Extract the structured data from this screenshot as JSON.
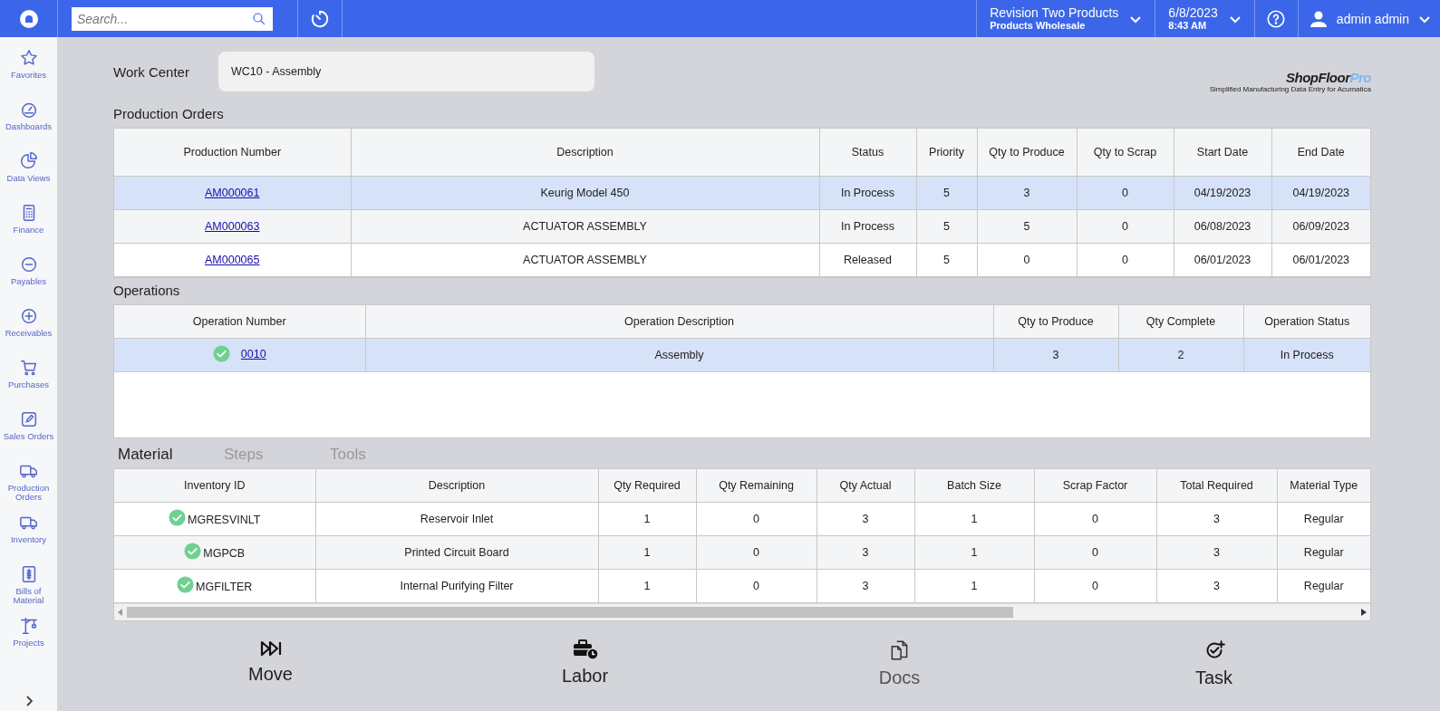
{
  "top_bar": {
    "search": {
      "placeholder": "Search..."
    },
    "company": {
      "name": "Revision Two Products",
      "branch": "Products Wholesale"
    },
    "datetime": {
      "date": "6/8/2023",
      "time": "8:43 AM"
    },
    "user": {
      "name": "admin admin"
    }
  },
  "sidebar": {
    "items": [
      {
        "label": "Favorites"
      },
      {
        "label": "Dashboards"
      },
      {
        "label": "Data Views"
      },
      {
        "label": "Finance"
      },
      {
        "label": "Payables"
      },
      {
        "label": "Receivables"
      },
      {
        "label": "Purchases"
      },
      {
        "label": "Sales Orders"
      },
      {
        "label": "Production Orders"
      },
      {
        "label": "Inventory"
      },
      {
        "label": "Bills of Material"
      },
      {
        "label": "Projects"
      }
    ]
  },
  "work_center": {
    "label": "Work Center",
    "value": "WC10 - Assembly"
  },
  "logo": {
    "name": "ShopFloor",
    "accent": "Pro",
    "tagline": "Simplified Manufacturing Data Entry for Acumatica"
  },
  "production_orders": {
    "title": "Production Orders",
    "columns": [
      "Production Number",
      "Description",
      "Status",
      "Priority",
      "Qty to Produce",
      "Qty to Scrap",
      "Start Date",
      "End Date"
    ],
    "rows": [
      {
        "selected": true,
        "cells": [
          "AM000061",
          "Keurig Model 450",
          "In Process",
          "5",
          "3",
          "0",
          "04/19/2023",
          "04/19/2023"
        ]
      },
      {
        "selected": false,
        "cells": [
          "AM000063",
          "ACTUATOR ASSEMBLY",
          "In Process",
          "5",
          "5",
          "0",
          "06/08/2023",
          "06/09/2023"
        ]
      },
      {
        "selected": false,
        "cells": [
          "AM000065",
          "ACTUATOR ASSEMBLY",
          "Released",
          "5",
          "0",
          "0",
          "06/01/2023",
          "06/01/2023"
        ]
      }
    ]
  },
  "operations": {
    "title": "Operations",
    "columns": [
      "Operation Number",
      "Operation Description",
      "Qty to Produce",
      "Qty Complete",
      "Operation Status"
    ],
    "rows": [
      {
        "selected": true,
        "complete": true,
        "cells": [
          "0010",
          "Assembly",
          "3",
          "2",
          "In Process"
        ]
      }
    ]
  },
  "tabs": [
    {
      "label": "Material",
      "selected": true
    },
    {
      "label": "Steps",
      "selected": false
    },
    {
      "label": "Tools",
      "selected": false
    }
  ],
  "material": {
    "columns": [
      "Inventory ID",
      "Description",
      "Qty Required",
      "Qty Remaining",
      "Qty Actual",
      "Batch Size",
      "Scrap Factor",
      "Total Required",
      "Material Type"
    ],
    "rows": [
      {
        "complete": true,
        "cells": [
          "MGRESVINLT",
          "Reservoir Inlet",
          "1",
          "0",
          "3",
          "1",
          "0",
          "3",
          "Regular"
        ]
      },
      {
        "complete": true,
        "cells": [
          "MGPCB",
          "Printed Circuit Board",
          "1",
          "0",
          "3",
          "1",
          "0",
          "3",
          "Regular"
        ]
      },
      {
        "complete": true,
        "cells": [
          "MGFILTER",
          "Internal Purifying Filter",
          "1",
          "0",
          "3",
          "1",
          "0",
          "3",
          "Regular"
        ]
      }
    ]
  },
  "actions": [
    {
      "label": "Move",
      "disabled": false
    },
    {
      "label": "Labor",
      "disabled": false
    },
    {
      "label": "Docs",
      "disabled": true
    },
    {
      "label": "Task",
      "disabled": false
    }
  ]
}
